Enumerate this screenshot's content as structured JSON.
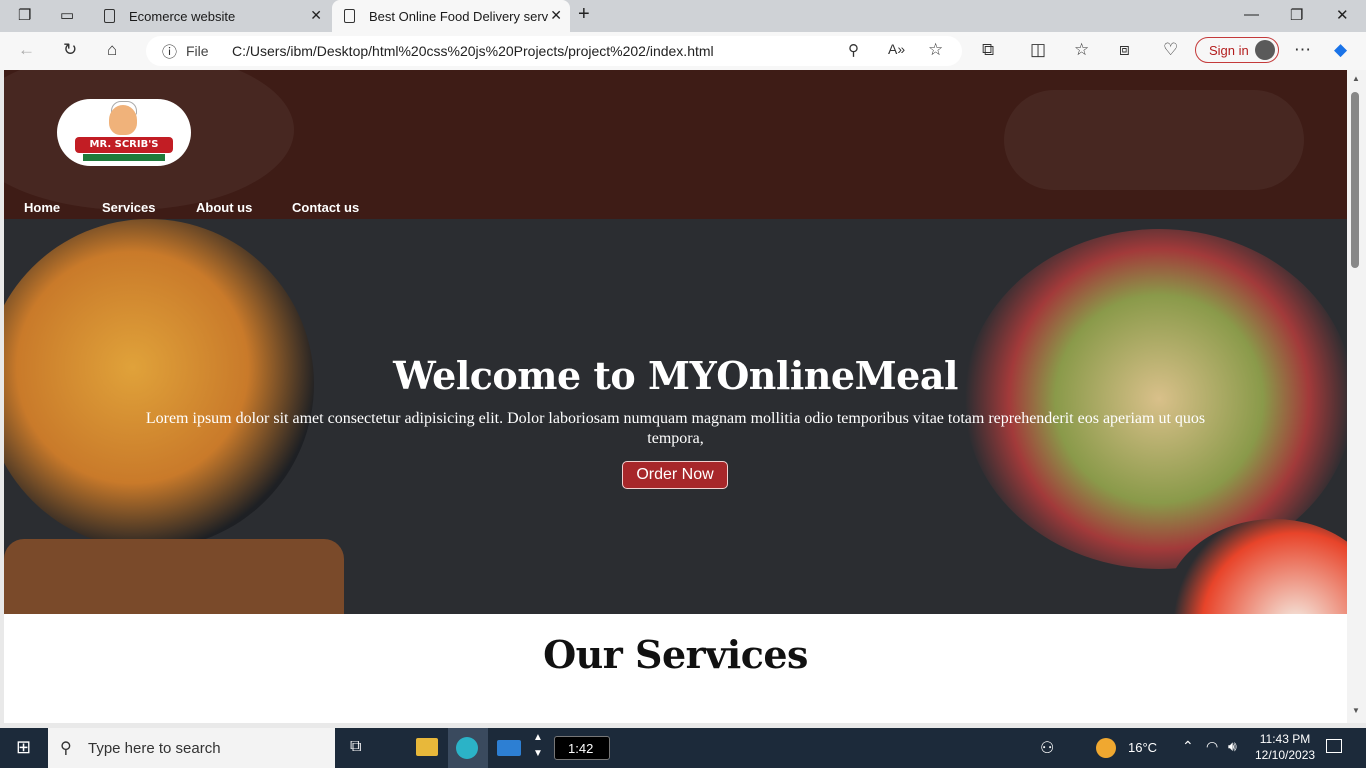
{
  "browser": {
    "tabs": [
      {
        "title": "Ecomerce website"
      },
      {
        "title": "Best Online Food Delivery service"
      }
    ],
    "address": {
      "scheme_label": "File",
      "url": "C:/Users/ibm/Desktop/html%20css%20js%20Projects/project%202/index.html"
    },
    "signin_label": "Sign in"
  },
  "site": {
    "logo": {
      "brand": "MR. SCRIB'S"
    },
    "nav": [
      "Home",
      "Services",
      "About us",
      "Contact us"
    ],
    "hero": {
      "title": "Welcome to MYOnlineMeal",
      "text": "Lorem ipsum dolor sit amet consectetur adipisicing elit. Dolor laboriosam numquam magnam mollitia odio temporibus vitae totam reprehenderit eos aperiam ut quos tempora,",
      "button": "Order Now"
    },
    "services_title": "Our Services"
  },
  "taskbar": {
    "search_placeholder": "Type here to search",
    "timer": "1:42",
    "temperature": "16°C",
    "time": "11:43 PM",
    "date": "12/10/2023"
  },
  "colors": {
    "header_bg": "#3e1c16",
    "button_bg": "#a7272a",
    "hero_bg": "#2b2d31"
  }
}
